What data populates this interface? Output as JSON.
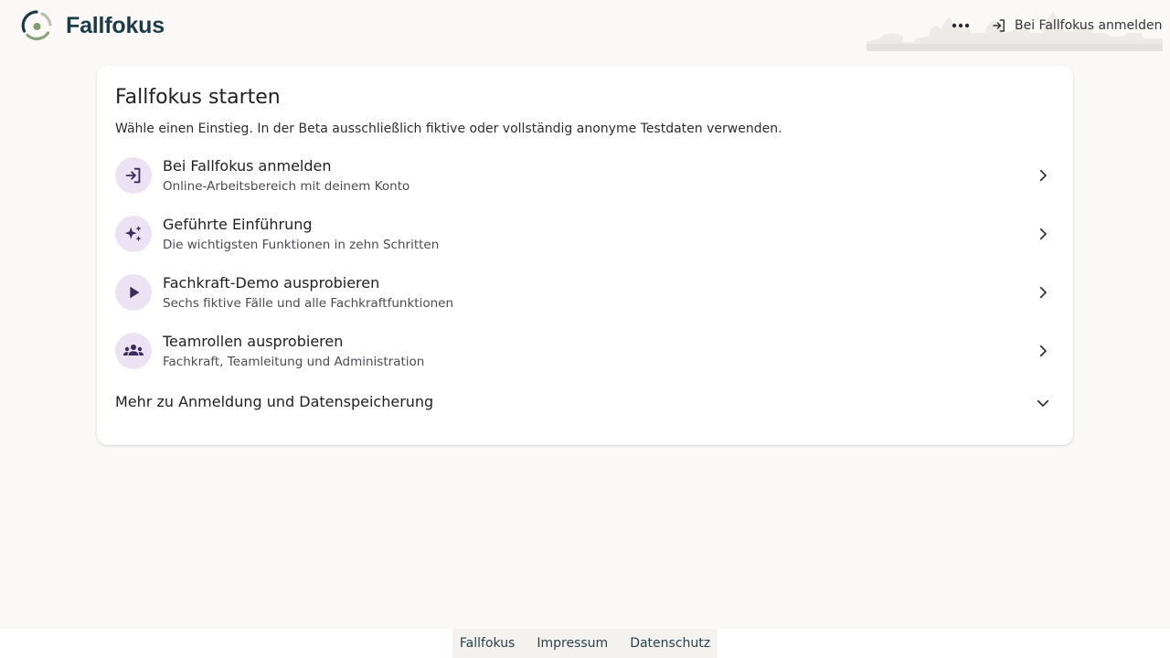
{
  "header": {
    "brand_name": "Fallfokus",
    "more_icon": "more-horizontal-icon",
    "login_label": "Bei Fallfokus anmelden",
    "login_icon": "login-icon"
  },
  "card": {
    "title": "Fallfokus starten",
    "subtitle": "Wähle einen Einstieg. In der Beta ausschließlich fiktive oder vollständig anonyme Testdaten verwenden.",
    "entries": [
      {
        "title": "Bei Fallfokus anmelden",
        "description": "Online-Arbeitsbereich mit deinem Konto",
        "icon": "login-icon"
      },
      {
        "title": "Geführte Einführung",
        "description": "Die wichtigsten Funktionen in zehn Schritten",
        "icon": "sparkle-icon"
      },
      {
        "title": "Fachkraft-Demo ausprobieren",
        "description": "Sechs fiktive Fälle und alle Fachkraftfunktionen",
        "icon": "play-icon"
      },
      {
        "title": "Teamrollen ausprobieren",
        "description": "Fachkraft, Teamleitung und Administration",
        "icon": "group-icon"
      }
    ],
    "more_info_label": "Mehr zu Anmeldung und Datenspeicherung"
  },
  "footer": {
    "links": [
      "Fallfokus",
      "Impressum",
      "Datenschutz"
    ]
  },
  "colors": {
    "background": "#faf9f7",
    "brand_text": "#1d3a48",
    "icon_circle": "#ebe3f3",
    "icon_fg": "#3b2a5c",
    "logo_green": "#8aa37a"
  }
}
